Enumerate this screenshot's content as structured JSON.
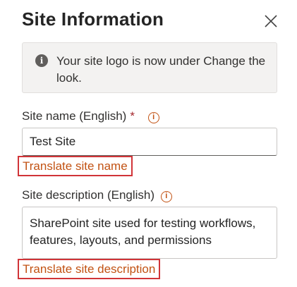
{
  "panel": {
    "title": "Site Information",
    "close_icon": "close-icon",
    "info_banner": {
      "icon": "info-icon",
      "text": "Your site logo is now under Change the look."
    }
  },
  "site_name": {
    "label": "Site name (English)",
    "required_mark": "*",
    "help_icon": "info-circle-icon",
    "value": "Test Site",
    "translate_link": "Translate site name"
  },
  "site_description": {
    "label": "Site description (English)",
    "help_icon": "info-circle-icon",
    "value": "SharePoint site used for testing workflows, features, layouts, and permissions",
    "translate_link": "Translate site description"
  },
  "colors": {
    "link": "#c25213",
    "highlight_border": "#d13438",
    "required": "#a4262c",
    "banner_bg": "#f3f2f1"
  }
}
